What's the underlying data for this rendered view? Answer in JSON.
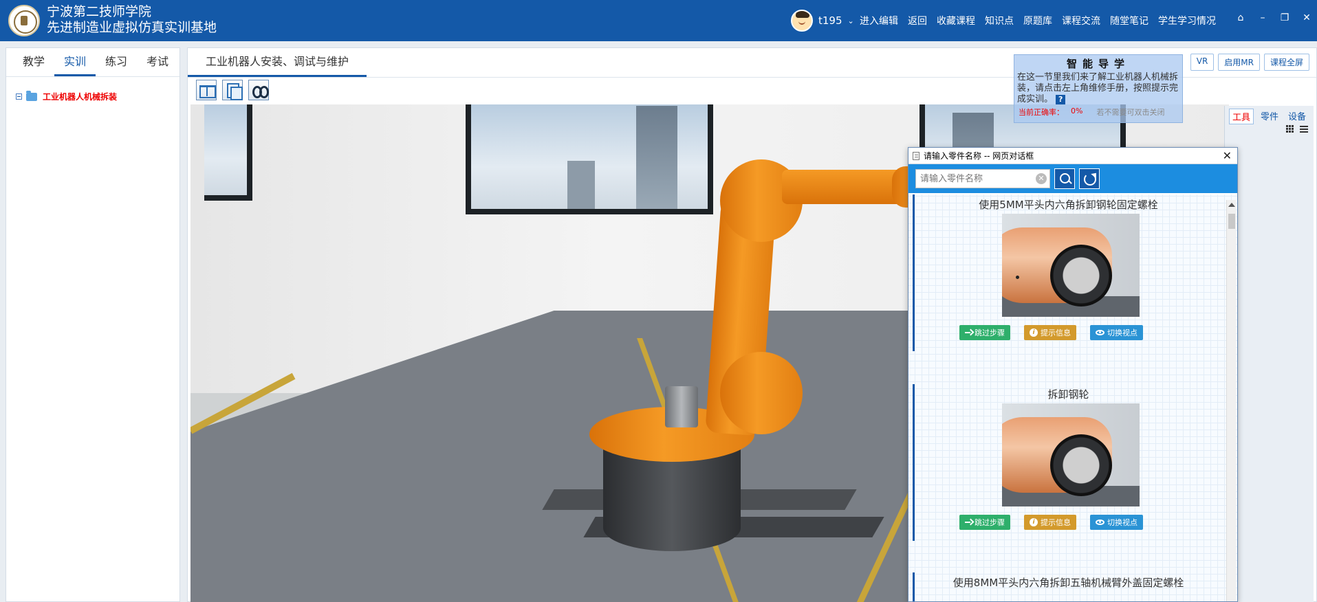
{
  "header": {
    "school_name": "宁波第二技师学院",
    "base_name": "先进制造业虚拟仿真实训基地",
    "username": "t195",
    "nav": [
      "进入编辑",
      "返回",
      "收藏课程",
      "知识点",
      "原题库",
      "课程交流",
      "随堂笔记",
      "学生学习情况"
    ]
  },
  "left_panel": {
    "tabs": [
      "教学",
      "实训",
      "练习",
      "考试"
    ],
    "active_tab": "实训",
    "tree_item": "工业机器人机械拆装"
  },
  "main": {
    "tab_title": "工业机器人安装、调试与维护",
    "top_buttons": [
      "VR",
      "启用MR",
      "课程全屏"
    ]
  },
  "guide": {
    "title": "智能导学",
    "text": "在这一节里我们来了解工业机器人机械拆装，请点击左上角维修手册，按照提示完成实训。",
    "help": "?",
    "accuracy_label": "当前正确率：",
    "accuracy_value": "0%",
    "close_tip": "若不需要可双击关闭"
  },
  "side_panel": {
    "tabs": [
      "工具",
      "零件",
      "设备"
    ],
    "active_tab": "工具"
  },
  "dialog": {
    "title": "请输入零件名称 -- 网页对话框",
    "search_placeholder": "请输入零件名称",
    "steps": [
      {
        "title": "使用5MM平头内六角拆卸钢轮固定螺栓"
      },
      {
        "title": "拆卸钢轮"
      },
      {
        "title": "使用8MM平头内六角拆卸五轴机械臂外盖固定螺栓"
      }
    ],
    "btn_skip": "跳过步骤",
    "btn_hint": "提示信息",
    "btn_view": "切换视点"
  }
}
